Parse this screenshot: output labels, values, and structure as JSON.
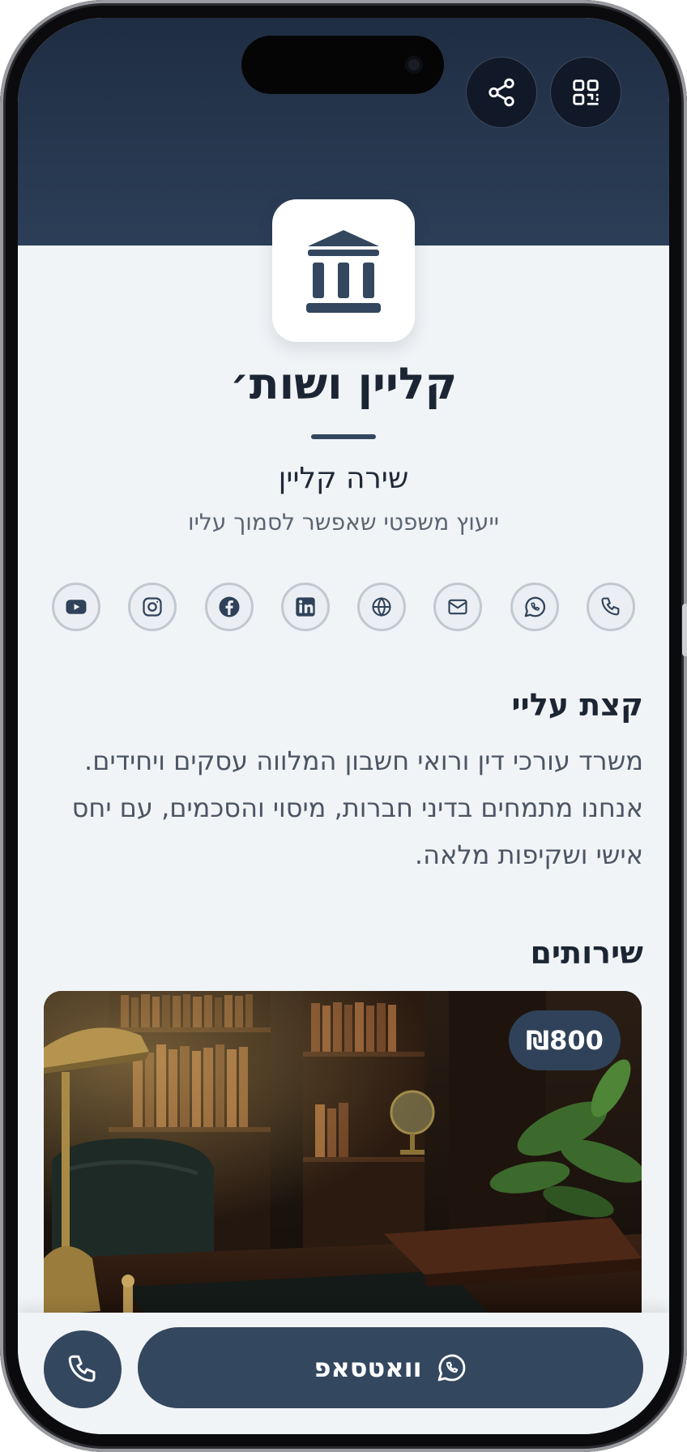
{
  "header": {
    "share_icon": "share-icon",
    "qr_icon": "qr-code-icon",
    "logo_icon": "bank-building-icon"
  },
  "profile": {
    "business_name": "קליין ושות׳",
    "person_name": "שירה קליין",
    "tagline": "ייעוץ משפטי שאפשר לסמוך עליו"
  },
  "social": [
    {
      "icon": "phone-icon"
    },
    {
      "icon": "whatsapp-icon"
    },
    {
      "icon": "email-icon"
    },
    {
      "icon": "globe-icon"
    },
    {
      "icon": "linkedin-icon"
    },
    {
      "icon": "facebook-icon"
    },
    {
      "icon": "instagram-icon"
    },
    {
      "icon": "youtube-icon"
    }
  ],
  "about": {
    "title": "קצת עליי",
    "text": "משרד עורכי דין ורואי חשבון המלווה עסקים ויחידים. אנחנו מתמחים בדיני חברות, מיסוי והסכמים, עם יחס אישי ושקיפות מלאה."
  },
  "services": {
    "title": "שירותים",
    "items": [
      {
        "price": "₪800",
        "image": "law-office-desk-photo"
      }
    ]
  },
  "bottom": {
    "whatsapp_label": "וואטסאפ",
    "call_icon": "phone-icon"
  },
  "colors": {
    "primary": "#33475f",
    "header_dark": "#1f2d42",
    "background": "#f1f4f7",
    "text_dark": "#1c2533",
    "text_muted": "#5b6472"
  }
}
